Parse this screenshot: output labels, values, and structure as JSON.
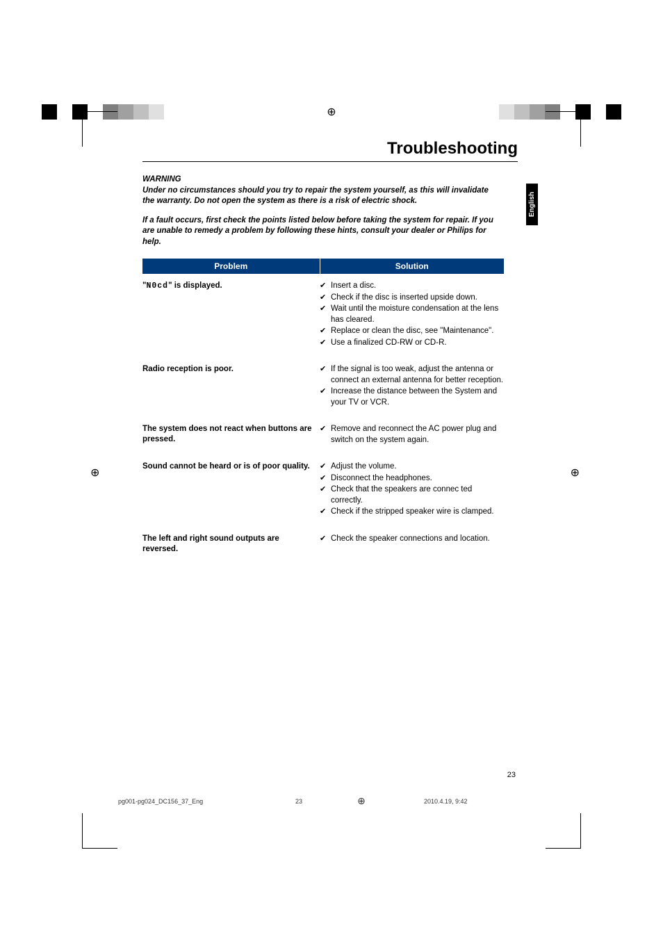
{
  "title": "Troubleshooting",
  "language_tab": "English",
  "warning": {
    "label": "WARNING",
    "text": "Under no circumstances should you try to repair the system yourself, as this will invalidate the warranty.  Do not open the system as there is a risk of electric shock."
  },
  "note": "If a fault occurs, first check the points listed below before taking the system for repair. If you are unable to remedy a problem by following these hints, consult your dealer or Philips for help.",
  "headers": {
    "problem": "Problem",
    "solution": "Solution"
  },
  "rows": [
    {
      "problem_prefix": "\"",
      "problem_display": "N0cd",
      "problem_suffix": "\" is displayed.",
      "solutions": [
        "Insert a disc.",
        "Check if the disc is inserted upside down.",
        "Wait until the moisture condensation at the lens has cleared.",
        "Replace or clean the disc, see \"Maintenance\".",
        "Use a finalized CD-RW or CD-R."
      ]
    },
    {
      "problem": "Radio reception is poor.",
      "solutions": [
        "If the signal is too weak, adjust the antenna or connect an external antenna for better reception.",
        "Increase the distance between the System and your TV or VCR."
      ]
    },
    {
      "problem": "The system does not react when buttons are pressed.",
      "solutions": [
        "Remove and reconnect the AC power plug and switch on the system again."
      ]
    },
    {
      "problem": "Sound cannot be heard or is of poor quality.",
      "solutions": [
        "Adjust the volume.",
        "Disconnect the headphones.",
        "Check that the speakers are connec ted correctly.",
        "Check if the stripped speaker wire is clamped."
      ]
    },
    {
      "problem": "The left and right sound outputs are reversed.",
      "solutions": [
        "Check the speaker connections and location."
      ]
    }
  ],
  "page_number": "23",
  "footer": {
    "filename": "pg001-pg024_DC156_37_Eng",
    "page": "23",
    "datetime": "2010.4.19, 9:42"
  },
  "colorbar_left": [
    "#000",
    "#fff",
    "#000",
    "#fff",
    "#7f7f7f",
    "#a0a0a0",
    "#c0c0c0",
    "#e0e0e0",
    "#fff",
    "#fff"
  ],
  "colorbar_right": [
    "#fff",
    "#fff",
    "#e0e0e0",
    "#c0c0c0",
    "#a0a0a0",
    "#7f7f7f",
    "#fff",
    "#000",
    "#fff",
    "#000"
  ]
}
